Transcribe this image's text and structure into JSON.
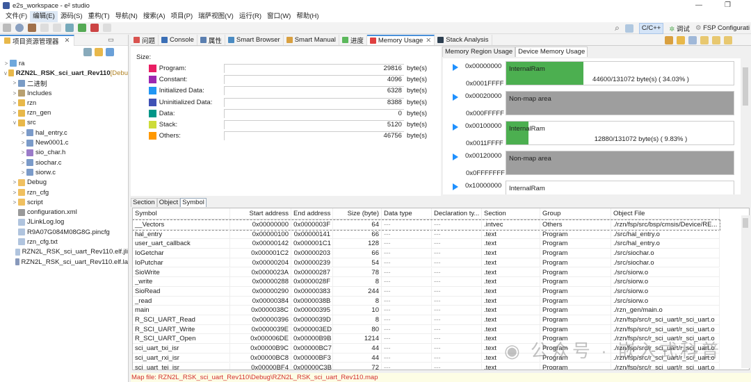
{
  "window": {
    "title": "e2s_workspace - e² studio",
    "controls": [
      "—",
      "❐",
      "✕"
    ]
  },
  "menu": [
    "文件(F)",
    "编辑(E)",
    "源码(S)",
    "重构(T)",
    "导航(N)",
    "搜索(A)",
    "项目(P)",
    "瑞萨视图(V)",
    "运行(R)",
    "窗口(W)",
    "帮助(H)"
  ],
  "perspectives": {
    "cpp": "C/C++",
    "debug": "调试",
    "fsp": "FSP Configurati"
  },
  "explorer": {
    "title": "项目资源管理器",
    "tree": [
      {
        "label": "ra",
        "depth": 0,
        "arrow": ">",
        "icon": "folder",
        "color": "#6fa8dc"
      },
      {
        "label": "RZN2L_RSK_sci_uart_Rev110",
        "suffix": " [Debu",
        "depth": 0,
        "arrow": "v",
        "icon": "project",
        "color": "#e8b84a",
        "bold": true
      },
      {
        "label": "二进制",
        "depth": 1,
        "arrow": ">",
        "icon": "binaries",
        "color": "#7a9cc6"
      },
      {
        "label": "Includes",
        "depth": 1,
        "arrow": ">",
        "icon": "includes",
        "color": "#b8a070"
      },
      {
        "label": "rzn",
        "depth": 1,
        "arrow": ">",
        "icon": "source-folder",
        "color": "#e8b84a"
      },
      {
        "label": "rzn_gen",
        "depth": 1,
        "arrow": ">",
        "icon": "source-folder",
        "color": "#e8b84a"
      },
      {
        "label": "src",
        "depth": 1,
        "arrow": "v",
        "icon": "source-folder",
        "color": "#e8b84a"
      },
      {
        "label": "hal_entry.c",
        "depth": 2,
        "arrow": ">",
        "icon": "c-file",
        "color": "#7b9bc9"
      },
      {
        "label": "New0001.c",
        "depth": 2,
        "arrow": ">",
        "icon": "c-file",
        "color": "#7b9bc9"
      },
      {
        "label": "sio_char.h",
        "depth": 2,
        "arrow": ">",
        "icon": "h-file",
        "color": "#9b7bc9"
      },
      {
        "label": "siochar.c",
        "depth": 2,
        "arrow": ">",
        "icon": "c-file",
        "color": "#7b9bc9"
      },
      {
        "label": "siorw.c",
        "depth": 2,
        "arrow": ">",
        "icon": "c-file",
        "color": "#7b9bc9"
      },
      {
        "label": "Debug",
        "depth": 1,
        "arrow": ">",
        "icon": "folder",
        "color": "#f0c060"
      },
      {
        "label": "rzn_cfg",
        "depth": 1,
        "arrow": ">",
        "icon": "folder",
        "color": "#f0c060"
      },
      {
        "label": "script",
        "depth": 1,
        "arrow": ">",
        "icon": "folder",
        "color": "#f0c060"
      },
      {
        "label": "configuration.xml",
        "depth": 1,
        "arrow": "",
        "icon": "gear",
        "color": "#999"
      },
      {
        "label": "JLinkLog.log",
        "depth": 1,
        "arrow": "",
        "icon": "file",
        "color": "#b0c4de"
      },
      {
        "label": "R9A07G084M08G8G.pincfg",
        "depth": 1,
        "arrow": "",
        "icon": "file",
        "color": "#b0c4de"
      },
      {
        "label": "rzn_cfg.txt",
        "depth": 1,
        "arrow": "",
        "icon": "file",
        "color": "#b0c4de"
      },
      {
        "label": "RZN2L_RSK_sci_uart_Rev110.elf.jli",
        "depth": 1,
        "arrow": "",
        "icon": "file",
        "color": "#b0c4de"
      },
      {
        "label": "RZN2L_RSK_sci_uart_Rev110.elf.la",
        "depth": 1,
        "arrow": "",
        "icon": "linker-file",
        "color": "#8899bb"
      }
    ]
  },
  "editor_tabs": [
    {
      "label": "问题",
      "color": "#d9534f"
    },
    {
      "label": "Console",
      "color": "#3b6fb6"
    },
    {
      "label": "属性",
      "color": "#5b7fb0"
    },
    {
      "label": "Smart Browser",
      "color": "#4a8bc2"
    },
    {
      "label": "Smart Manual",
      "color": "#d9a040"
    },
    {
      "label": "进度",
      "color": "#5cb85c"
    },
    {
      "label": "Memory Usage",
      "color": "#e04040",
      "selected": true,
      "closable": true
    },
    {
      "label": "Stack Analysis",
      "color": "#2c3e50"
    }
  ],
  "sizes": {
    "heading": "Size:",
    "unit": "byte(s)",
    "items": [
      {
        "label": "Program:",
        "value": 29816,
        "color": "#e91e63"
      },
      {
        "label": "Constant:",
        "value": 4096,
        "color": "#9c27b0"
      },
      {
        "label": "Initialized Data:",
        "value": 6328,
        "color": "#2196f3"
      },
      {
        "label": "Uninitialized Data:",
        "value": 8388,
        "color": "#3f51b5"
      },
      {
        "label": "Data:",
        "value": 0,
        "color": "#009688"
      },
      {
        "label": "Stack:",
        "value": 5120,
        "color": "#cddc39"
      },
      {
        "label": "Others:",
        "value": 46756,
        "color": "#ff9800"
      }
    ]
  },
  "device": {
    "tabs": [
      "Memory Region Usage",
      "Device Memory Usage"
    ],
    "selected_tab": 1,
    "regions": [
      {
        "start": "0x00000000",
        "end": "0x0001FFFF",
        "name": "InternalRam",
        "usage": "44600/131072 byte(s) ( 34.03% )",
        "percent": 34.03
      },
      {
        "start": "0x00020000",
        "end": "0x000FFFFF",
        "name": "Non-map area",
        "nonmap": true
      },
      {
        "start": "0x00100000",
        "end": "0x0011FFFF",
        "name": "InternalRam",
        "usage": "12880/131072 byte(s) ( 9.83% )",
        "percent": 9.83
      },
      {
        "start": "0x00120000",
        "end": "0x0FFFFFFF",
        "name": "Non-map area",
        "nonmap": true
      },
      {
        "start": "0x10000000",
        "end": "",
        "name": "InternalRam"
      }
    ]
  },
  "symbol_tabs": [
    "Section",
    "Object",
    "Symbol"
  ],
  "symbol_selected_tab": 2,
  "table": {
    "columns": [
      "Symbol",
      "Start address",
      "End address",
      "Size (byte)",
      "Data type",
      "Declaration ty...",
      "Section",
      "Group",
      "Object File"
    ],
    "rows": [
      [
        "__Vectors",
        "0x00000000",
        "0x0000003F",
        "64",
        "---",
        "---",
        ".intvec",
        "Others",
        "./rzn/fsp/src/bsp/cmsis/Device/RE..."
      ],
      [
        "hal_entry",
        "0x00000100",
        "0x00000141",
        "66",
        "---",
        "---",
        ".text",
        "Program",
        "./src/hal_entry.o"
      ],
      [
        "user_uart_callback",
        "0x00000142",
        "0x000001C1",
        "128",
        "---",
        "---",
        ".text",
        "Program",
        "./src/hal_entry.o"
      ],
      [
        "IoGetchar",
        "0x000001C2",
        "0x00000203",
        "66",
        "---",
        "---",
        ".text",
        "Program",
        "./src/siochar.o"
      ],
      [
        "IoPutchar",
        "0x00000204",
        "0x00000239",
        "54",
        "---",
        "---",
        ".text",
        "Program",
        "./src/siochar.o"
      ],
      [
        "SioWrite",
        "0x0000023A",
        "0x00000287",
        "78",
        "---",
        "---",
        ".text",
        "Program",
        "./src/siorw.o"
      ],
      [
        "_write",
        "0x00000288",
        "0x0000028F",
        "8",
        "---",
        "---",
        ".text",
        "Program",
        "./src/siorw.o"
      ],
      [
        "SioRead",
        "0x00000290",
        "0x00000383",
        "244",
        "---",
        "---",
        ".text",
        "Program",
        "./src/siorw.o"
      ],
      [
        "_read",
        "0x00000384",
        "0x0000038B",
        "8",
        "---",
        "---",
        ".text",
        "Program",
        "./src/siorw.o"
      ],
      [
        "main",
        "0x0000038C",
        "0x00000395",
        "10",
        "---",
        "---",
        ".text",
        "Program",
        "./rzn_gen/main.o"
      ],
      [
        "R_SCI_UART_Read",
        "0x00000396",
        "0x0000039D",
        "8",
        "---",
        "---",
        ".text",
        "Program",
        "./rzn/fsp/src/r_sci_uart/r_sci_uart.o"
      ],
      [
        "R_SCI_UART_Write",
        "0x0000039E",
        "0x000003ED",
        "80",
        "---",
        "---",
        ".text",
        "Program",
        "./rzn/fsp/src/r_sci_uart/r_sci_uart.o"
      ],
      [
        "R_SCI_UART_Open",
        "0x000006DE",
        "0x00000B9B",
        "1214",
        "---",
        "---",
        ".text",
        "Program",
        "./rzn/fsp/src/r_sci_uart/r_sci_uart.o"
      ],
      [
        "sci_uart_txi_isr",
        "0x00000B9C",
        "0x00000BC7",
        "44",
        "---",
        "---",
        ".text",
        "Program",
        "./rzn/fsp/src/r_sci_uart/r_sci_uart.o"
      ],
      [
        "sci_uart_rxi_isr",
        "0x00000BC8",
        "0x00000BF3",
        "44",
        "---",
        "---",
        ".text",
        "Program",
        "./rzn/fsp/src/r_sci_uart/r_sci_uart.o"
      ],
      [
        "sci_uart_tei_isr",
        "0x00000BF4",
        "0x00000C3B",
        "72",
        "---",
        "---",
        ".text",
        "Program",
        "./rzn/fsp/src/r_sci_uart/r_sci_uart.o"
      ]
    ]
  },
  "status": "Map file: RZN2L_RSK_sci_uart_Rev110\\Debug\\RZN2L_RSK_sci_uart_Rev110.map",
  "watermark": "公众号 · 嵌入式科普"
}
